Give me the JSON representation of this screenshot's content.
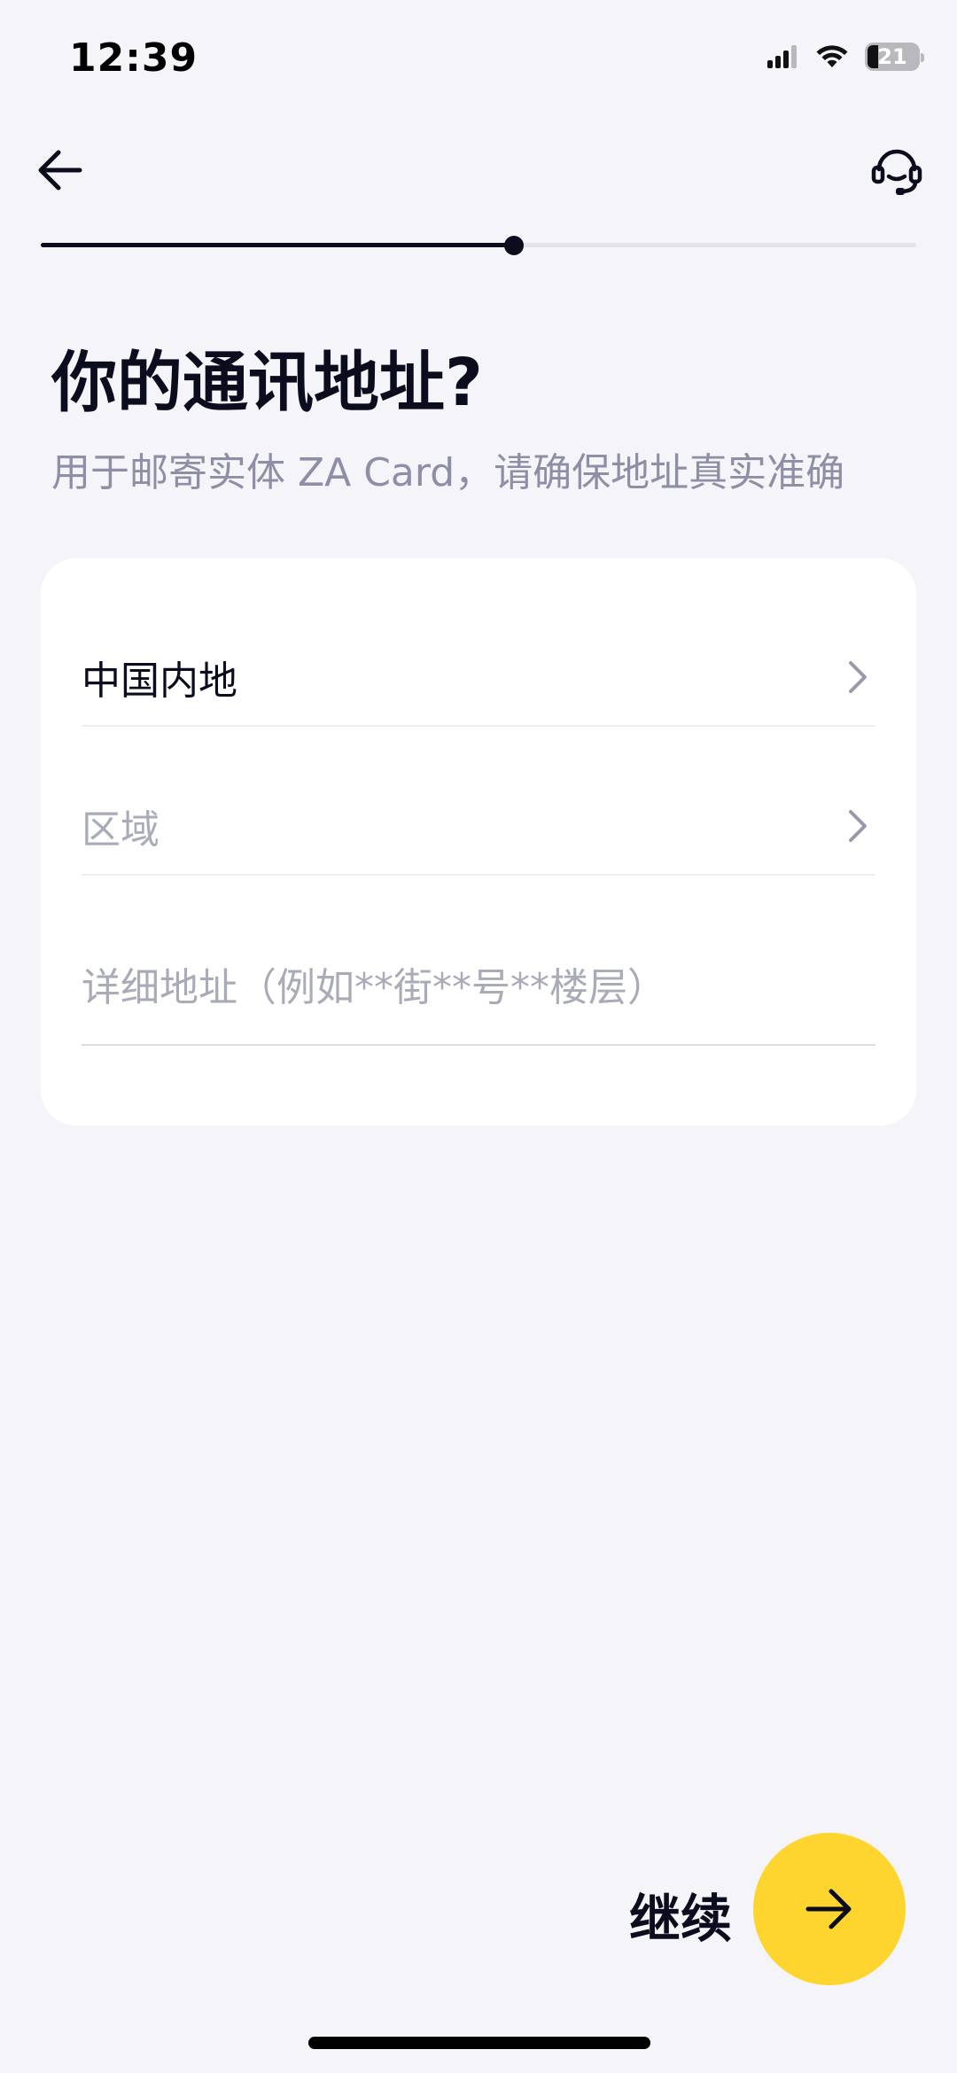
{
  "status_bar": {
    "time": "12:39",
    "battery_level": "21",
    "battery_fraction": 0.21,
    "icons": [
      "signal-icon",
      "wifi-icon",
      "battery-icon"
    ]
  },
  "nav": {
    "back_icon": "arrow-left-icon",
    "support_icon": "headset-icon"
  },
  "progress": {
    "fraction": 0.54
  },
  "header": {
    "title": "你的通讯地址?",
    "subtitle": "用于邮寄实体 ZA Card，请确保地址真实准确"
  },
  "form": {
    "country": {
      "value": "中国内地"
    },
    "area": {
      "placeholder": "区域"
    },
    "address": {
      "value": "",
      "placeholder": "详细地址（例如**街**号**楼层）"
    }
  },
  "footer": {
    "continue_label": "继续",
    "continue_icon": "arrow-right-icon"
  },
  "colors": {
    "background": "#f4f4f9",
    "card": "#ffffff",
    "accent": "#fed52f",
    "text_primary": "#0b0d1f",
    "text_secondary": "#8e8fa6",
    "placeholder": "#a9abb7"
  }
}
